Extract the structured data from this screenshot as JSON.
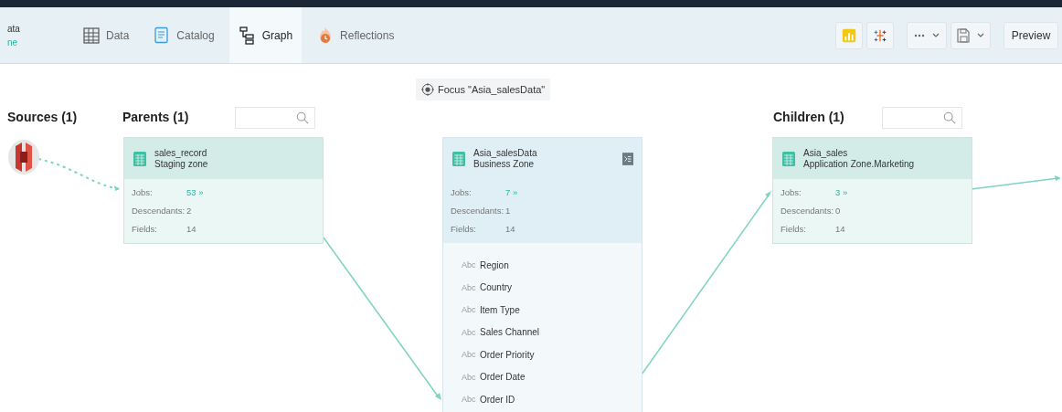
{
  "dataset": {
    "title": "ata",
    "subtitle": "ne"
  },
  "tabs": [
    {
      "label": "Data",
      "selected": false
    },
    {
      "label": "Catalog",
      "selected": false
    },
    {
      "label": "Graph",
      "selected": true
    },
    {
      "label": "Reflections",
      "selected": false
    }
  ],
  "toolbar": [
    {
      "kind": "chart"
    },
    {
      "kind": "tableau"
    },
    {
      "kind": "more"
    },
    {
      "kind": "save"
    },
    {
      "kind": "text",
      "label": "Preview"
    }
  ],
  "focus_button": {
    "label": "Focus \"Asia_salesData\""
  },
  "sources": {
    "heading": "Sources (1)"
  },
  "parents": {
    "heading": "Parents (1)",
    "node": {
      "name": "sales_record",
      "zone": "Staging zone",
      "stats": [
        {
          "label": "Jobs:",
          "value": "53 »",
          "kind": "link"
        },
        {
          "label": "Descendants:",
          "value": "2",
          "kind": "plain"
        },
        {
          "label": "Fields:",
          "value": "14",
          "kind": "plain"
        }
      ]
    }
  },
  "focus_node": {
    "name": "Asia_salesData",
    "zone": "Business Zone",
    "stats": [
      {
        "label": "Jobs:",
        "value": "7 »",
        "kind": "link"
      },
      {
        "label": "Descendants:",
        "value": "1",
        "kind": "plain"
      },
      {
        "label": "Fields:",
        "value": "14",
        "kind": "plain"
      }
    ],
    "fields": [
      {
        "type": "Abc",
        "name": "Region"
      },
      {
        "type": "Abc",
        "name": "Country"
      },
      {
        "type": "Abc",
        "name": "Item Type"
      },
      {
        "type": "Abc",
        "name": "Sales Channel"
      },
      {
        "type": "Abc",
        "name": "Order Priority"
      },
      {
        "type": "Abc",
        "name": "Order Date"
      },
      {
        "type": "Abc",
        "name": "Order ID"
      }
    ]
  },
  "children": {
    "heading": "Children (1)",
    "node": {
      "name": "Asia_sales",
      "zone": "Application Zone.Marketing",
      "stats": [
        {
          "label": "Jobs:",
          "value": "3 »",
          "kind": "link"
        },
        {
          "label": "Descendants:",
          "value": "0",
          "kind": "plain"
        },
        {
          "label": "Fields:",
          "value": "14",
          "kind": "plain"
        }
      ]
    }
  }
}
